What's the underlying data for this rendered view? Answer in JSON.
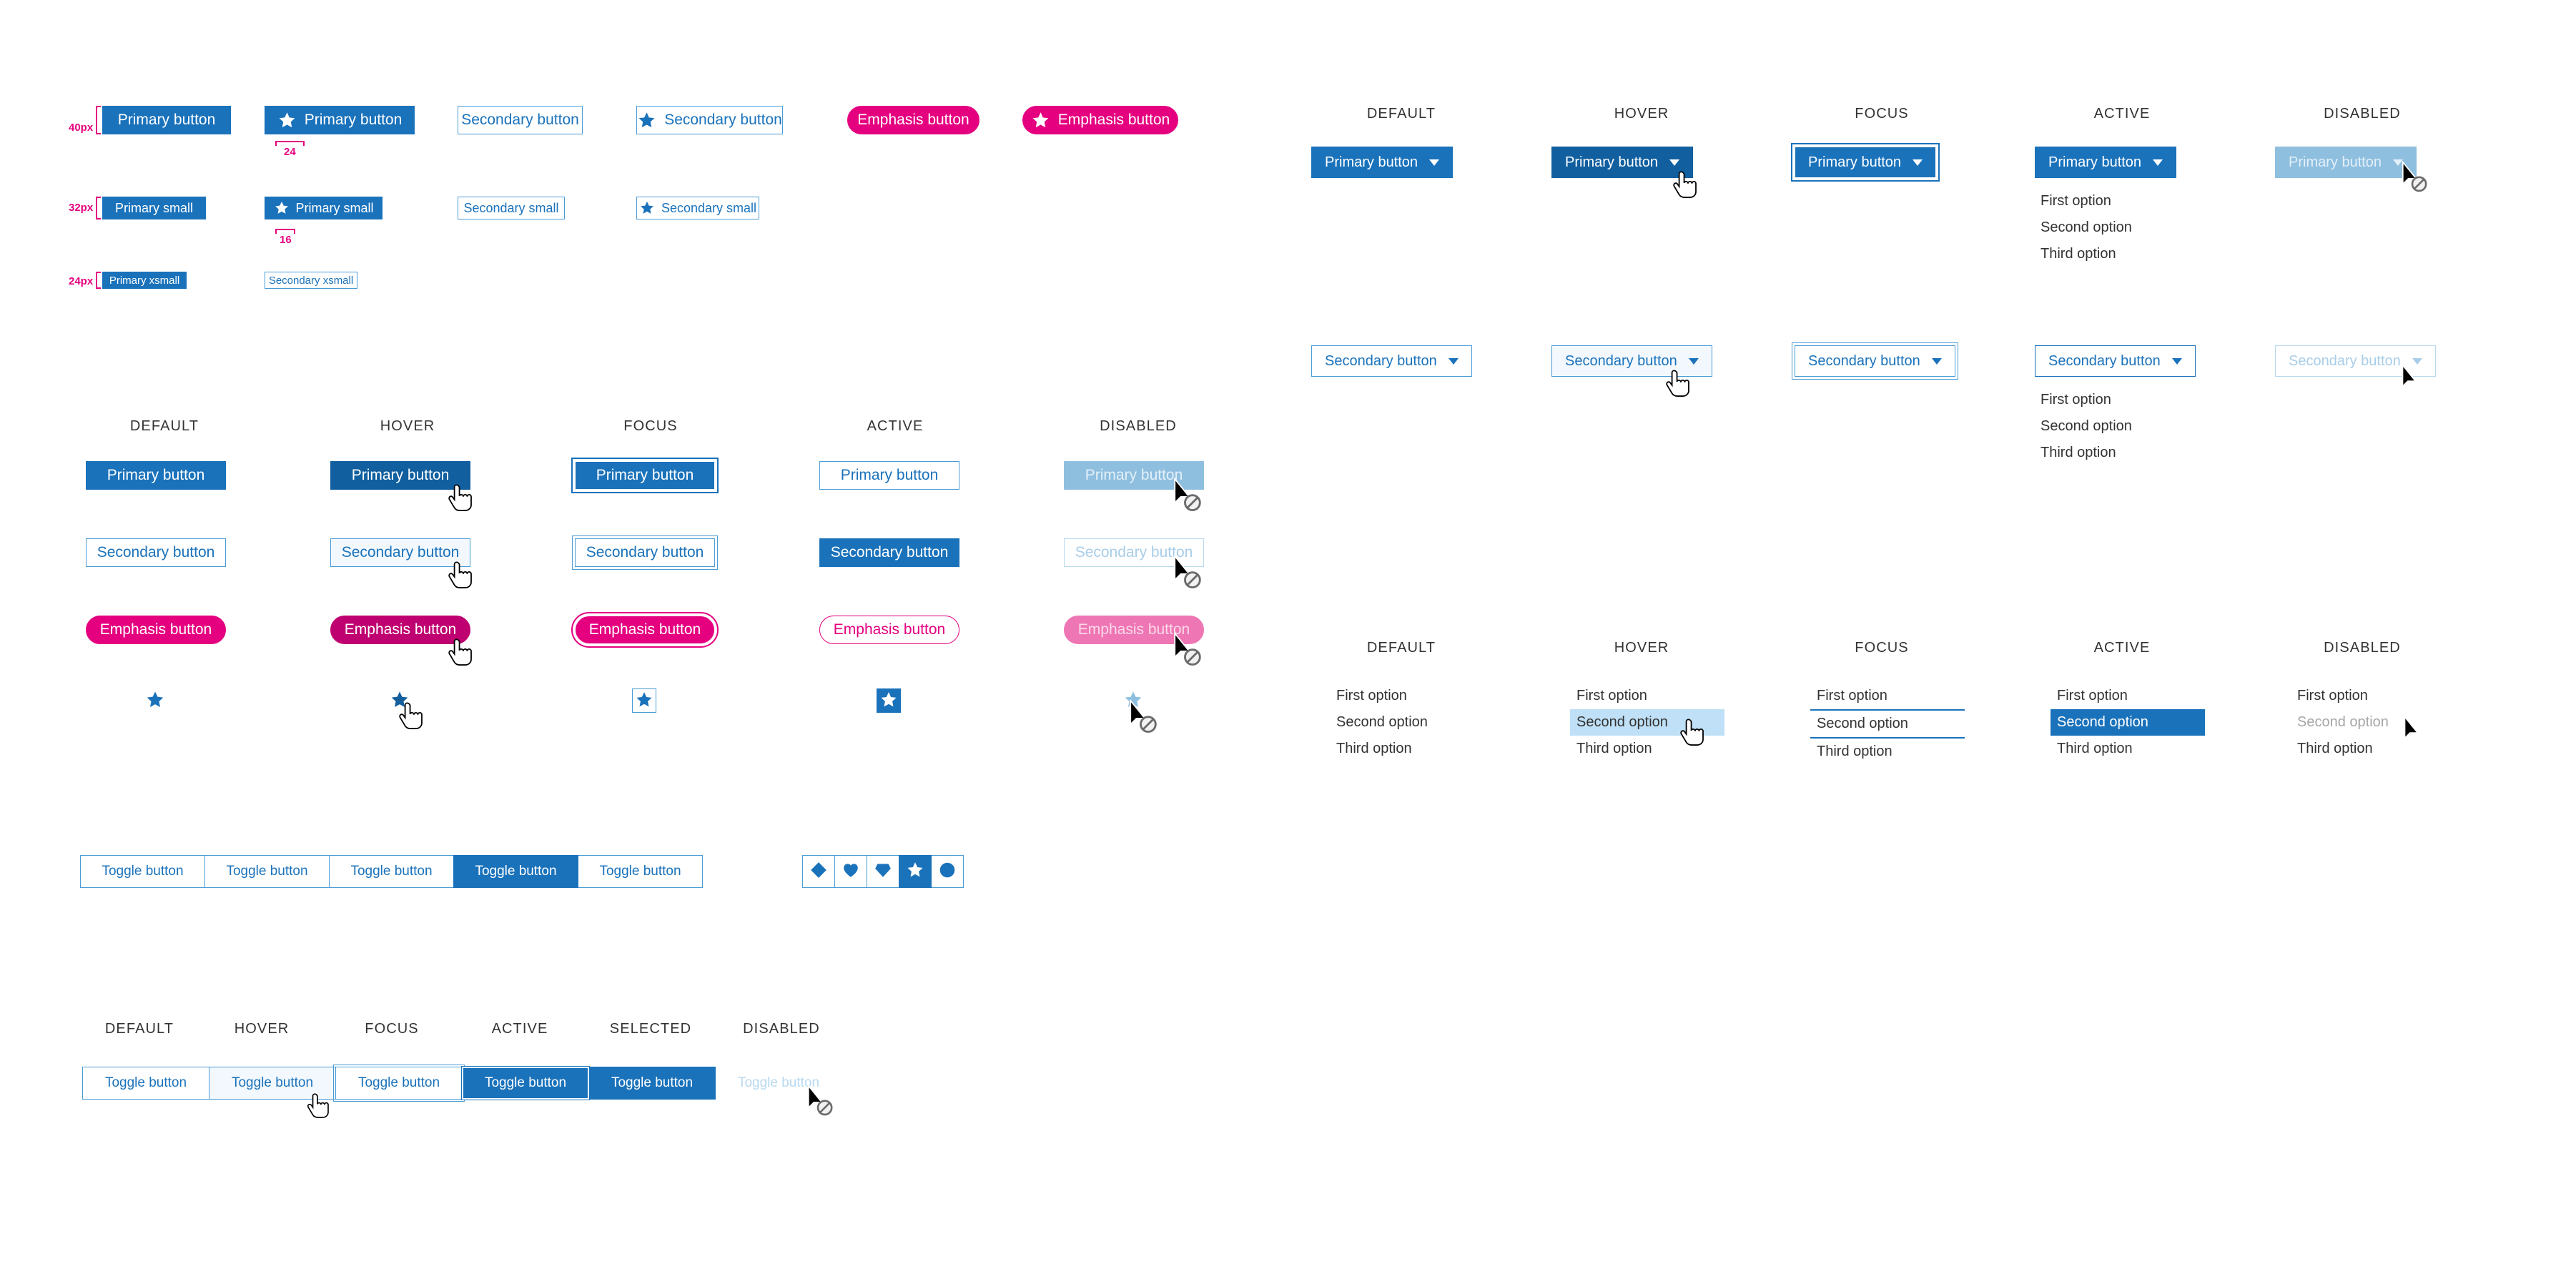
{
  "labels": {
    "default": "DEFAULT",
    "hover": "HOVER",
    "focus": "FOCUS",
    "active": "ACTIVE",
    "selected": "SELECTED",
    "disabled": "DISABLED"
  },
  "sizes": {
    "primary_button": "Primary button",
    "secondary_button": "Secondary button",
    "emphasis_button": "Emphasis button",
    "primary_small": "Primary small",
    "secondary_small": "Secondary small",
    "primary_xsmall": "Primary xsmall",
    "secondary_xsmall": "Secondary xsmall",
    "measure_40": "40px",
    "measure_32": "32px",
    "measure_24": "24px",
    "gap_24": "24",
    "gap_16": "16"
  },
  "toggle": {
    "label": "Toggle button"
  },
  "icons": {
    "star": "star-icon",
    "diamond": "diamond-icon",
    "heart": "heart-icon",
    "gem": "gem-icon",
    "circle": "circle-icon",
    "caret": "caret-down-icon"
  },
  "dropdown": {
    "primary_label": "Primary button",
    "secondary_label": "Secondary button"
  },
  "options": {
    "first": "First option",
    "second": "Second option",
    "third": "Third option"
  },
  "colors": {
    "primary_blue": "#1a72bb",
    "hover_blue": "#115f9f",
    "border_blue": "#4a9cd6",
    "light_blue_bg": "#f2f8fd",
    "option_hover_bg": "#bfe0f7",
    "emphasis_pink": "#e4007f",
    "emphasis_hover_pink": "#bf0070",
    "disabled_blue": "#8fbfdf",
    "disabled_pink": "#ef76b4",
    "measure_pink": "#e4007f",
    "text_dark": "#333333"
  }
}
